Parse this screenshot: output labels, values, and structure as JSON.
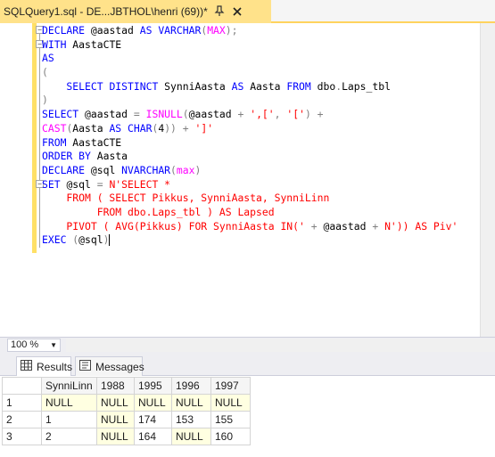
{
  "tab": {
    "title": "SQLQuery1.sql - DE...JBTHOL\\henri (69))*",
    "pin_icon": "pin-icon",
    "close_icon": "close-icon"
  },
  "editor": {
    "lines": [
      [
        {
          "t": "DECLARE ",
          "c": "kw"
        },
        {
          "t": "@aastad ",
          "c": "tx"
        },
        {
          "t": "AS ",
          "c": "kw"
        },
        {
          "t": "VARCHAR",
          "c": "kw"
        },
        {
          "t": "(",
          "c": "op"
        },
        {
          "t": "MAX",
          "c": "fn"
        },
        {
          "t": ");",
          "c": "op"
        }
      ],
      [
        {
          "t": "WITH ",
          "c": "kw"
        },
        {
          "t": "AastaCTE",
          "c": "tx"
        }
      ],
      [
        {
          "t": "AS",
          "c": "kw"
        }
      ],
      [
        {
          "t": "(",
          "c": "op"
        }
      ],
      [
        {
          "t": "    SELECT ",
          "c": "kw"
        },
        {
          "t": "DISTINCT ",
          "c": "kw"
        },
        {
          "t": "SynniAasta ",
          "c": "tx"
        },
        {
          "t": "AS ",
          "c": "kw"
        },
        {
          "t": "Aasta ",
          "c": "tx"
        },
        {
          "t": "FROM ",
          "c": "kw"
        },
        {
          "t": "dbo",
          "c": "tx"
        },
        {
          "t": ".",
          "c": "op"
        },
        {
          "t": "Laps_tbl",
          "c": "tx"
        }
      ],
      [
        {
          "t": ")",
          "c": "op"
        }
      ],
      [
        {
          "t": "SELECT ",
          "c": "kw"
        },
        {
          "t": "@aastad ",
          "c": "tx"
        },
        {
          "t": "= ",
          "c": "op"
        },
        {
          "t": "ISNULL",
          "c": "fn"
        },
        {
          "t": "(",
          "c": "op"
        },
        {
          "t": "@aastad ",
          "c": "tx"
        },
        {
          "t": "+ ",
          "c": "op"
        },
        {
          "t": "',['",
          "c": "str"
        },
        {
          "t": ", ",
          "c": "op"
        },
        {
          "t": "'['",
          "c": "str"
        },
        {
          "t": ") +",
          "c": "op"
        }
      ],
      [
        {
          "t": "CAST",
          "c": "fn"
        },
        {
          "t": "(",
          "c": "op"
        },
        {
          "t": "Aasta ",
          "c": "tx"
        },
        {
          "t": "AS ",
          "c": "kw"
        },
        {
          "t": "CHAR",
          "c": "kw"
        },
        {
          "t": "(",
          "c": "op"
        },
        {
          "t": "4",
          "c": "tx"
        },
        {
          "t": ")) + ",
          "c": "op"
        },
        {
          "t": "']'",
          "c": "str"
        }
      ],
      [
        {
          "t": "FROM ",
          "c": "kw"
        },
        {
          "t": "AastaCTE",
          "c": "tx"
        }
      ],
      [
        {
          "t": "ORDER BY ",
          "c": "kw"
        },
        {
          "t": "Aasta",
          "c": "tx"
        }
      ],
      [
        {
          "t": "DECLARE ",
          "c": "kw"
        },
        {
          "t": "@sql ",
          "c": "tx"
        },
        {
          "t": "NVARCHAR",
          "c": "kw"
        },
        {
          "t": "(",
          "c": "op"
        },
        {
          "t": "max",
          "c": "fn"
        },
        {
          "t": ")",
          "c": "op"
        }
      ],
      [
        {
          "t": "SET ",
          "c": "kw"
        },
        {
          "t": "@sql ",
          "c": "tx"
        },
        {
          "t": "= ",
          "c": "op"
        },
        {
          "t": "N'SELECT *",
          "c": "str"
        }
      ],
      [
        {
          "t": "    FROM ( SELECT Pikkus, SynniAasta, SynniLinn",
          "c": "str"
        }
      ],
      [
        {
          "t": "         FROM dbo.Laps_tbl ) AS Lapsed",
          "c": "str"
        }
      ],
      [
        {
          "t": "    PIVOT ( AVG(Pikkus) FOR SynniAasta IN('",
          "c": "str"
        },
        {
          "t": " + ",
          "c": "op"
        },
        {
          "t": "@aastad ",
          "c": "tx"
        },
        {
          "t": "+ ",
          "c": "op"
        },
        {
          "t": "N'))",
          "c": "str"
        },
        {
          "t": " AS Piv'",
          "c": "str"
        }
      ],
      [
        {
          "t": "EXEC ",
          "c": "kw"
        },
        {
          "t": "(",
          "c": "op"
        },
        {
          "t": "@sql",
          "c": "tx"
        },
        {
          "t": ")",
          "c": "op"
        }
      ]
    ]
  },
  "zoom": {
    "value": "100 %"
  },
  "result_tabs": [
    {
      "label": "Results",
      "icon": "grid-icon"
    },
    {
      "label": "Messages",
      "icon": "messages-icon"
    }
  ],
  "grid": {
    "columns": [
      "SynniLinn",
      "1988",
      "1995",
      "1996",
      "1997"
    ],
    "rows": [
      {
        "num": "1",
        "cells": [
          "NULL",
          "NULL",
          "NULL",
          "NULL",
          "NULL"
        ]
      },
      {
        "num": "2",
        "cells": [
          "1",
          "NULL",
          "174",
          "153",
          "155"
        ]
      },
      {
        "num": "3",
        "cells": [
          "2",
          "NULL",
          "164",
          "NULL",
          "160"
        ]
      }
    ]
  },
  "colors": {
    "tab_active": "#ffe28a",
    "keyword": "#0000ff",
    "function": "#ff00ff",
    "string": "#ff0000",
    "null_cell": "#ffffe1"
  }
}
